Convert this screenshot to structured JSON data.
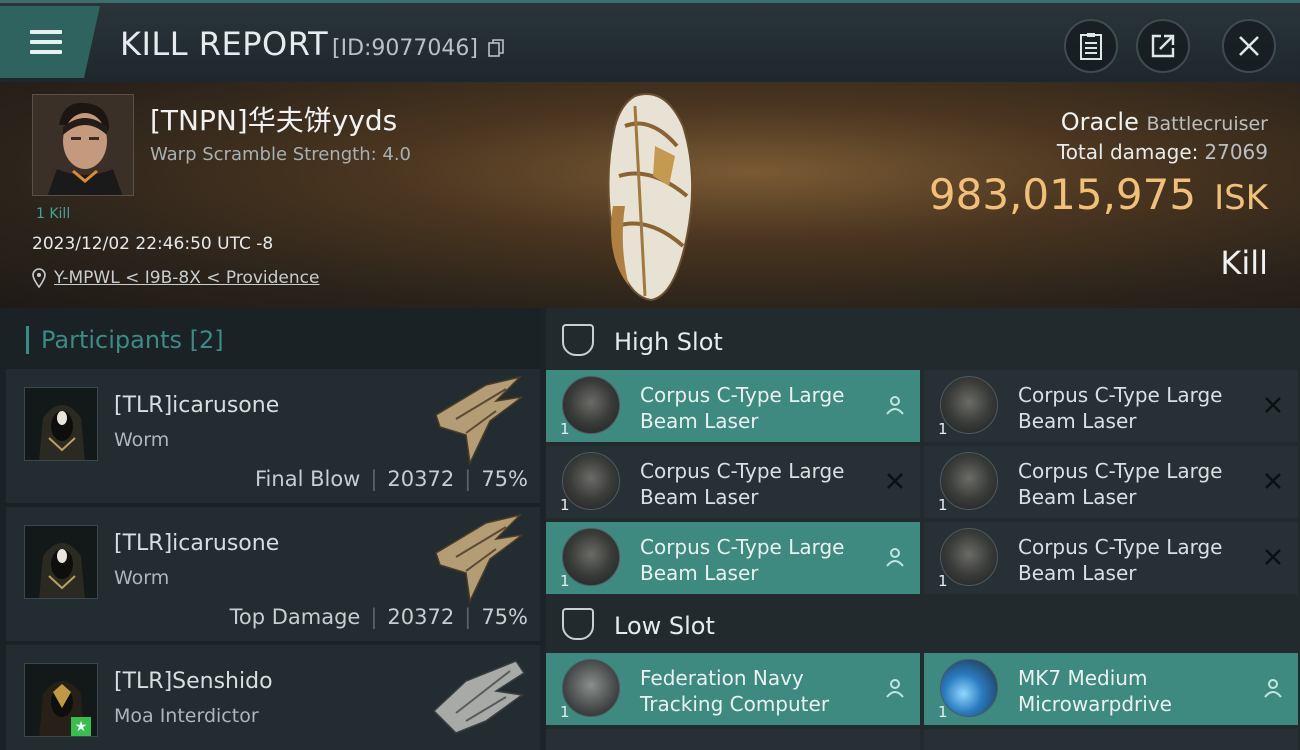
{
  "header": {
    "title": "KILL REPORT",
    "report_id": "[ID:9077046]"
  },
  "victim": {
    "name": "[TNPN]华夫饼yyds",
    "subtitle": "Warp Scramble Strength: 4.0",
    "kills": "1 Kill",
    "datetime": "2023/12/02 22:46:50 UTC -8",
    "location": "Y-MPWL < I9B-8X < Providence",
    "ship_name": "Oracle",
    "ship_class": "Battlecruiser",
    "total_damage_label": "Total damage:",
    "total_damage": "27069",
    "isk_value": "983,015,975",
    "isk_unit": "ISK",
    "result": "Kill"
  },
  "participants": {
    "title": "Participants",
    "count": "[2]",
    "items": [
      {
        "name": "[TLR]icarusone",
        "ship": "Worm",
        "role": "Final Blow",
        "damage": "20372",
        "percent": "75%"
      },
      {
        "name": "[TLR]icarusone",
        "ship": "Worm",
        "role": "Top Damage",
        "damage": "20372",
        "percent": "75%"
      },
      {
        "name": "[TLR]Senshido",
        "ship": "Moa Interdictor"
      }
    ]
  },
  "slots": {
    "high": {
      "label": "High Slot",
      "modules": [
        {
          "name": "Corpus C-Type Large Beam Laser",
          "qty": "1",
          "status": "user-icon"
        },
        {
          "name": "Corpus C-Type Large Beam Laser",
          "qty": "1",
          "status": "destroyed-icon"
        },
        {
          "name": "Corpus C-Type Large Beam Laser",
          "qty": "1",
          "status": "destroyed-icon"
        },
        {
          "name": "Corpus C-Type Large Beam Laser",
          "qty": "1",
          "status": "destroyed-icon"
        },
        {
          "name": "Corpus C-Type Large Beam Laser",
          "qty": "1",
          "status": "user-icon"
        },
        {
          "name": "Corpus C-Type Large Beam Laser",
          "qty": "1",
          "status": "destroyed-icon"
        }
      ]
    },
    "low": {
      "label": "Low Slot",
      "modules": [
        {
          "name": "Federation Navy Tracking Computer",
          "qty": "1",
          "status": "user-icon"
        },
        {
          "name": "MK7 Medium Microwarpdrive",
          "qty": "1",
          "status": "user-icon"
        }
      ]
    }
  },
  "colors": {
    "accent": "#3f8a80",
    "isk": "#f0c078",
    "menu": "#2f6360"
  }
}
